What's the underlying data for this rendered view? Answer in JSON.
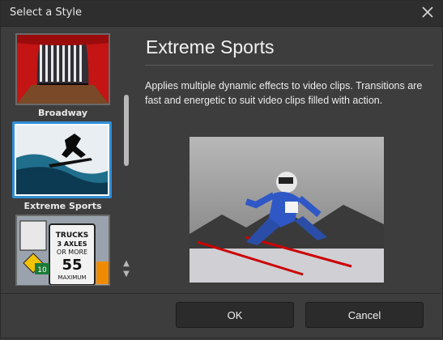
{
  "window": {
    "title": "Select a Style"
  },
  "styles": [
    {
      "label": "Broadway"
    },
    {
      "label": "Extreme Sports"
    },
    {
      "label": ""
    }
  ],
  "detail": {
    "heading": "Extreme Sports",
    "description": "Applies multiple dynamic effects to video clips. Transitions are fast and energetic to suit video clips filled with action."
  },
  "buttons": {
    "ok": "OK",
    "cancel": "Cancel"
  },
  "icons": {
    "close": "close-icon",
    "scroll_up": "chevron-up-icon",
    "scroll_down": "chevron-down-icon"
  },
  "colors": {
    "accent": "#2f8fd8"
  }
}
